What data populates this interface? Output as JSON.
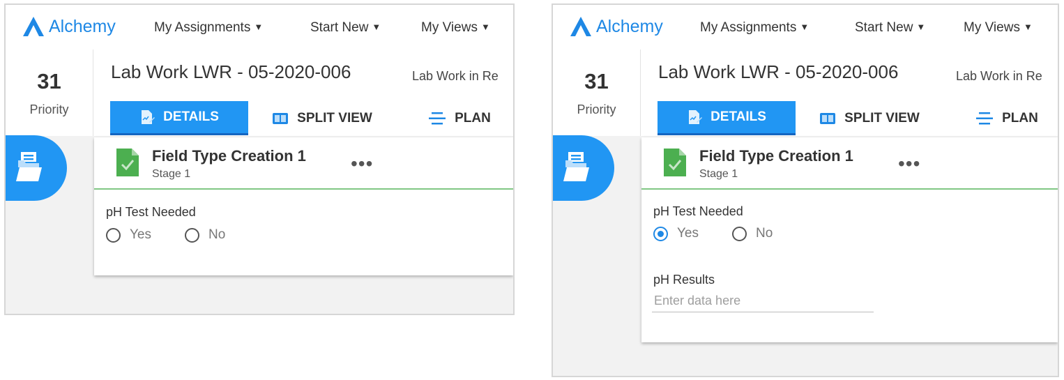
{
  "panels": [
    {
      "brand": "Alchemy",
      "nav": {
        "assignments": "My Assignments",
        "start_new": "Start New",
        "views": "My Views"
      },
      "priority": {
        "value": "31",
        "label": "Priority"
      },
      "title": "Lab Work LWR - 05-2020-006",
      "subtitle": "Lab Work in Re",
      "tabs": {
        "details": "DETAILS",
        "split": "SPLIT VIEW",
        "plan": "PLAN"
      },
      "card": {
        "title": "Field Type Creation 1",
        "stage": "Stage 1",
        "more": "•••",
        "ph_test_label": "pH Test Needed",
        "yes": "Yes",
        "no": "No",
        "selected": "none"
      }
    },
    {
      "brand": "Alchemy",
      "nav": {
        "assignments": "My Assignments",
        "start_new": "Start New",
        "views": "My Views"
      },
      "priority": {
        "value": "31",
        "label": "Priority"
      },
      "title": "Lab Work LWR - 05-2020-006",
      "subtitle": "Lab Work in Re",
      "tabs": {
        "details": "DETAILS",
        "split": "SPLIT VIEW",
        "plan": "PLAN"
      },
      "card": {
        "title": "Field Type Creation 1",
        "stage": "Stage 1",
        "more": "•••",
        "ph_test_label": "pH Test Needed",
        "yes": "Yes",
        "no": "No",
        "selected": "yes",
        "ph_results_label": "pH Results",
        "ph_results_placeholder": "Enter data here",
        "ph_results_value": ""
      }
    }
  ],
  "colors": {
    "accent": "#2196f3",
    "brand": "#1e88e5",
    "card_divider": "#81c784",
    "doc_icon": "#4caf50"
  },
  "icons": {
    "logo": "alchemy-logo-icon",
    "details_tab": "document-edit-icon",
    "split_tab": "split-view-icon",
    "plan_tab": "plan-lines-icon",
    "fab": "open-folder-icon",
    "card": "checked-document-icon",
    "more": "more-horizontal-icon",
    "chevron": "chevron-down-icon"
  }
}
